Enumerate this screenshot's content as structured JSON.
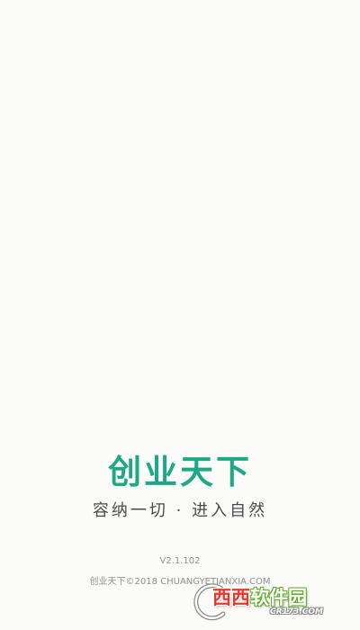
{
  "splash": {
    "app_title": "创业天下",
    "slogan": "容纳一切 · 进入自然",
    "version": "V2.1.102",
    "copyright": "创业天下©2018 CHUANGYETIANXIA.COM"
  },
  "watermark": {
    "brand_red": "西西",
    "brand_rest": "软件园",
    "url": "CR173.COM"
  },
  "colors": {
    "background": "#fbfcfa",
    "accent_green": "#1fa886",
    "slogan_text": "#4a4a4a",
    "muted_text": "#8f8f8f"
  }
}
